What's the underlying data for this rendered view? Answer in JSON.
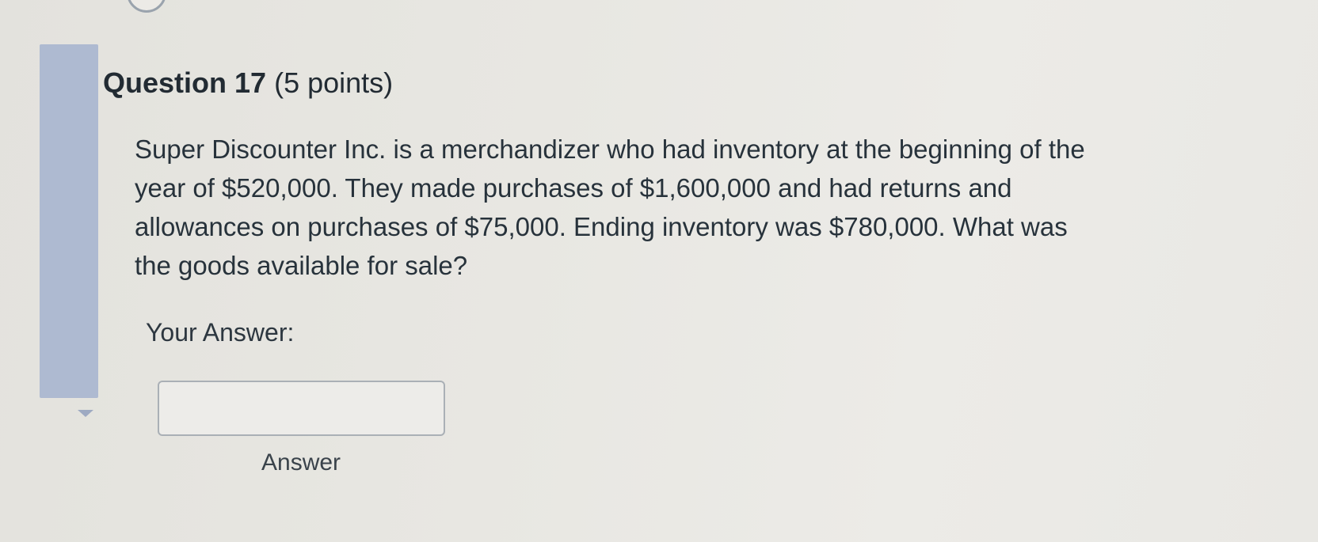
{
  "question": {
    "title_number": "Question 17",
    "title_points": "(5 points)",
    "text_lines": [
      "Super Discounter Inc. is a merchandizer who had inventory at the beginning of the",
      "year of $520,000.  They made purchases of $1,600,000 and had returns and",
      "allowances on purchases of $75,000.  Ending inventory was $780,000.  What was",
      "the goods available for sale?"
    ]
  },
  "answer": {
    "label": "Your Answer:",
    "value": "",
    "caption": "Answer"
  },
  "colors": {
    "sidebar_marker": "#aebad1",
    "background": "#e8e7e2",
    "text": "#26313a"
  },
  "icons": {
    "collapse": "caret-down-icon"
  }
}
